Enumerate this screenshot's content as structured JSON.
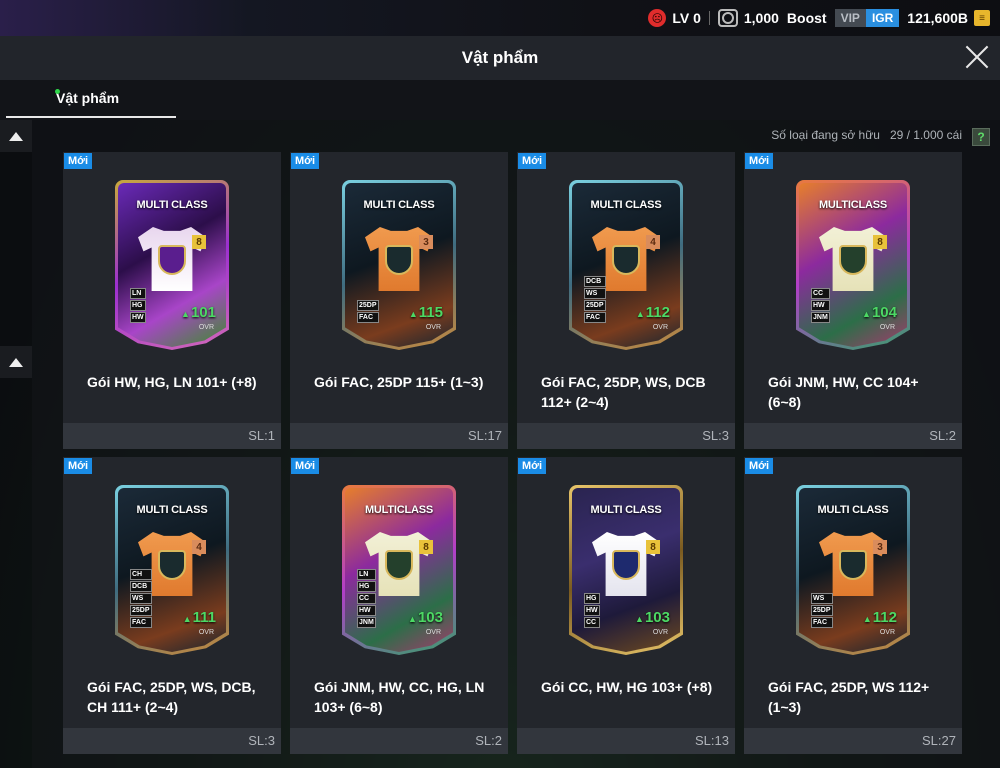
{
  "status_bar": {
    "level": "LV 0",
    "coins": "1,000",
    "boost": "Boost",
    "vip": "VIP",
    "igr": "IGR",
    "balance": "121,600B"
  },
  "header": {
    "title": "Vật phẩm"
  },
  "tabs": [
    {
      "label": "Vật phẩm",
      "active": true
    }
  ],
  "owned": {
    "label": "Số loại đang sở hữu",
    "value": "29 / 1.000 cái",
    "help": "?"
  },
  "items": [
    {
      "name": "Gói HW, HG, LN 101+ (+8)",
      "qty": "SL:1",
      "badge": "Mới",
      "card_title": "MULTI CLASS",
      "level": "8",
      "ovr": "101",
      "ovr_label": "OVR",
      "positions": [
        "LN",
        "HG",
        "HW"
      ]
    },
    {
      "name": "Gói FAC, 25DP 115+ (1~3)",
      "qty": "SL:17",
      "badge": "Mới",
      "card_title": "MULTI CLASS",
      "level": "3",
      "ovr": "115",
      "ovr_label": "OVR",
      "positions": [
        "25DP",
        "FAC"
      ]
    },
    {
      "name": "Gói FAC, 25DP, WS, DCB 112+ (2~4)",
      "qty": "SL:3",
      "badge": "Mới",
      "card_title": "MULTI CLASS",
      "level": "4",
      "ovr": "112",
      "ovr_label": "OVR",
      "positions": [
        "DCB",
        "WS",
        "25DP",
        "FAC"
      ]
    },
    {
      "name": "Gói JNM, HW, CC 104+ (6~8)",
      "qty": "SL:2",
      "badge": "Mới",
      "card_title": "MULTICLASS",
      "level": "8",
      "ovr": "104",
      "ovr_label": "OVR",
      "positions": [
        "CC",
        "HW",
        "JNM"
      ]
    },
    {
      "name": "Gói FAC, 25DP, WS, DCB, CH 111+ (2~4)",
      "qty": "SL:3",
      "badge": "Mới",
      "card_title": "MULTI CLASS",
      "level": "4",
      "ovr": "111",
      "ovr_label": "OVR",
      "positions": [
        "CH",
        "DCB",
        "WS",
        "25DP",
        "FAC"
      ]
    },
    {
      "name": "Gói JNM, HW, CC, HG, LN 103+ (6~8)",
      "qty": "SL:2",
      "badge": "Mới",
      "card_title": "MULTICLASS",
      "level": "8",
      "ovr": "103",
      "ovr_label": "OVR",
      "positions": [
        "LN",
        "HG",
        "CC",
        "HW",
        "JNM"
      ]
    },
    {
      "name": "Gói CC, HW, HG 103+ (+8)",
      "qty": "SL:13",
      "badge": "Mới",
      "card_title": "MULTI CLASS",
      "level": "8",
      "ovr": "103",
      "ovr_label": "OVR",
      "positions": [
        "HG",
        "HW",
        "CC"
      ]
    },
    {
      "name": "Gói FAC, 25DP, WS 112+ (1~3)",
      "qty": "SL:27",
      "badge": "Mới",
      "card_title": "MULTI CLASS",
      "level": "3",
      "ovr": "112",
      "ovr_label": "OVR",
      "positions": [
        "WS",
        "25DP",
        "FAC"
      ]
    }
  ],
  "colors": {
    "accent": "#1a8ce6",
    "ovr_green": "#4cd964",
    "tab_dot": "#2fd64a"
  }
}
